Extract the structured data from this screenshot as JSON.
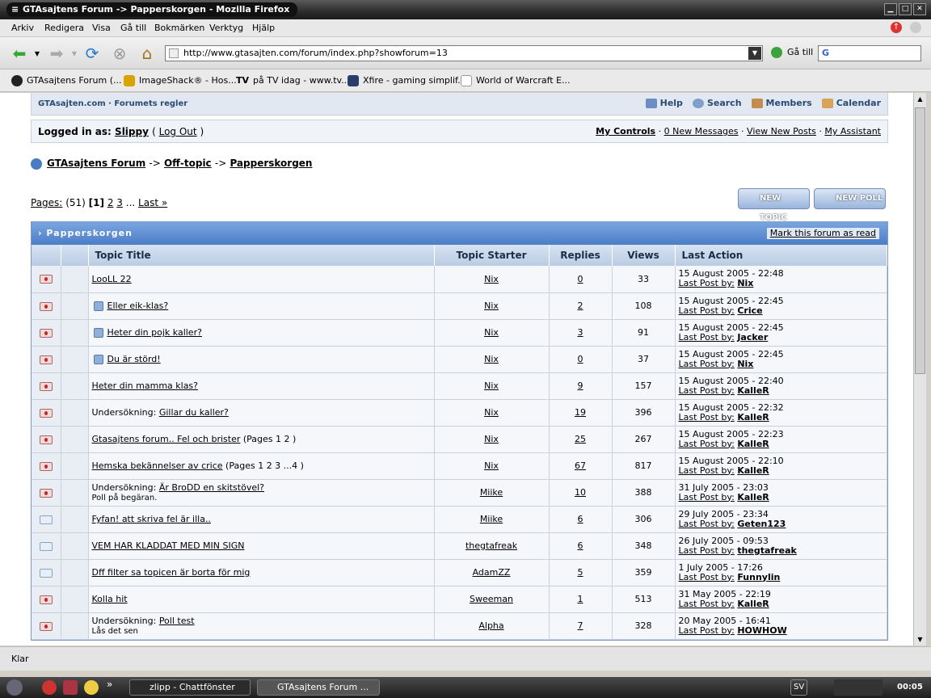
{
  "window": {
    "title": "GTAsajtens Forum -> Papperskorgen - Mozilla Firefox"
  },
  "menu": [
    "Arkiv",
    "Redigera",
    "Visa",
    "Gå till",
    "Bokmärken",
    "Verktyg",
    "Hjälp"
  ],
  "url": "http://www.gtasajten.com/forum/index.php?showforum=13",
  "goto_label": "Gå till",
  "bookmarks": [
    "GTAsajtens Forum (...",
    "ImageShack® - Hos...",
    "på TV idag - www.tv...",
    "Xfire - gaming simplif...",
    "World of Warcraft E..."
  ],
  "forum": {
    "topnav_left": "GTAsajten.com · Forumets regler",
    "help": "Help",
    "search": "Search",
    "members": "Members",
    "calendar": "Calendar",
    "logged_in_label": "Logged in as:",
    "user": "Slippy",
    "logout": "Log Out",
    "my_controls": "My Controls",
    "new_messages": "0 New Messages",
    "view_new_posts": "View New Posts",
    "my_assistant": "My Assistant",
    "crumb": [
      "GTAsajtens Forum",
      "Off-topic",
      "Papperskorgen"
    ],
    "crumb_sep": "->",
    "pages_label": "Pages:",
    "pages_count": "(51)",
    "page_current": "[1]",
    "page_2": "2",
    "page_3": "3",
    "page_ellipsis": "...",
    "page_last": "Last »",
    "new_topic": "NEW TOPIC",
    "new_poll": "NEW POLL",
    "table_title": "Papperskorgen",
    "mark_read": "Mark this forum as read",
    "headers": {
      "title": "Topic Title",
      "starter": "Topic Starter",
      "replies": "Replies",
      "views": "Views",
      "last": "Last Action"
    },
    "last_post_by": "Last Post by:",
    "rows": [
      {
        "icon": "hot",
        "pinned": false,
        "prefix": "",
        "title": "LooLL 22",
        "suffix": "",
        "sub": "",
        "starter": "Nix",
        "replies": "0",
        "views": "33",
        "date": "15 August 2005 - 22:48",
        "last": "Nix"
      },
      {
        "icon": "hot",
        "pinned": true,
        "prefix": "",
        "title": "Eller eik-klas?",
        "suffix": "",
        "sub": "",
        "starter": "Nix",
        "replies": "2",
        "views": "108",
        "date": "15 August 2005 - 22:45",
        "last": "Crice"
      },
      {
        "icon": "hot",
        "pinned": true,
        "prefix": "",
        "title": "Heter din pojk kaller?",
        "suffix": "",
        "sub": "",
        "starter": "Nix",
        "replies": "3",
        "views": "91",
        "date": "15 August 2005 - 22:45",
        "last": "Jacker"
      },
      {
        "icon": "hot",
        "pinned": true,
        "prefix": "",
        "title": "Du är störd!",
        "suffix": "",
        "sub": "",
        "starter": "Nix",
        "replies": "0",
        "views": "37",
        "date": "15 August 2005 - 22:45",
        "last": "Nix"
      },
      {
        "icon": "hot",
        "pinned": false,
        "prefix": "",
        "title": "Heter din mamma klas?",
        "suffix": "",
        "sub": "",
        "starter": "Nix",
        "replies": "9",
        "views": "157",
        "date": "15 August 2005 - 22:40",
        "last": "KalleR"
      },
      {
        "icon": "hot",
        "pinned": false,
        "prefix": "Undersökning: ",
        "title": "Gillar du kaller?",
        "suffix": "",
        "sub": "",
        "starter": "Nix",
        "replies": "19",
        "views": "396",
        "date": "15 August 2005 - 22:32",
        "last": "KalleR"
      },
      {
        "icon": "hot",
        "pinned": false,
        "prefix": "",
        "title": "Gtasajtens forum.. Fel och brister",
        "suffix": " (Pages 1 2 )",
        "sub": "",
        "starter": "Nix",
        "replies": "25",
        "views": "267",
        "date": "15 August 2005 - 22:23",
        "last": "KalleR"
      },
      {
        "icon": "hot",
        "pinned": false,
        "prefix": "",
        "title": "Hemska bekännelser av crice",
        "suffix": " (Pages 1 2 3 ...4 )",
        "sub": "",
        "starter": "Nix",
        "replies": "67",
        "views": "817",
        "date": "15 August 2005 - 22:10",
        "last": "KalleR"
      },
      {
        "icon": "hot",
        "pinned": false,
        "prefix": "Undersökning: ",
        "title": "Är BroDD en skitstövel?",
        "suffix": "",
        "sub": "Poll på begäran.",
        "starter": "Miike",
        "replies": "10",
        "views": "388",
        "date": "31 July 2005 - 23:03",
        "last": "KalleR"
      },
      {
        "icon": "env",
        "pinned": false,
        "prefix": "",
        "title": "Fyfan! att skriva fel är illa..",
        "suffix": "",
        "sub": "",
        "starter": "Miike",
        "replies": "6",
        "views": "306",
        "date": "29 July 2005 - 23:34",
        "last": "Geten123"
      },
      {
        "icon": "env",
        "pinned": false,
        "prefix": "",
        "title": "VEM HAR KLADDAT MED MIN SIGN",
        "suffix": "",
        "sub": "",
        "starter": "thegtafreak",
        "replies": "6",
        "views": "348",
        "date": "26 July 2005 - 09:53",
        "last": "thegtafreak"
      },
      {
        "icon": "env",
        "pinned": false,
        "prefix": "",
        "title": "Dff filter sa topicen är borta för mig",
        "suffix": "",
        "sub": "",
        "starter": "AdamZZ",
        "replies": "5",
        "views": "359",
        "date": "1 July 2005 - 17:26",
        "last": "Funnylin"
      },
      {
        "icon": "hot",
        "pinned": false,
        "prefix": "",
        "title": "Kolla hit",
        "suffix": "",
        "sub": "",
        "starter": "Sweeman",
        "replies": "1",
        "views": "513",
        "date": "31 May 2005 - 22:19",
        "last": "KalleR"
      },
      {
        "icon": "hot",
        "pinned": false,
        "prefix": "Undersökning: ",
        "title": "Poll test",
        "suffix": "",
        "sub": "Lås det sen",
        "starter": "Alpha",
        "replies": "7",
        "views": "328",
        "date": "20 May 2005 - 16:41",
        "last": "HOWHOW"
      }
    ]
  },
  "status": "Klar",
  "taskbar": {
    "item1": "zlipp - Chattfönster",
    "item2": "GTAsajtens Forum ...",
    "lang": "SV",
    "clock": "00:05"
  }
}
